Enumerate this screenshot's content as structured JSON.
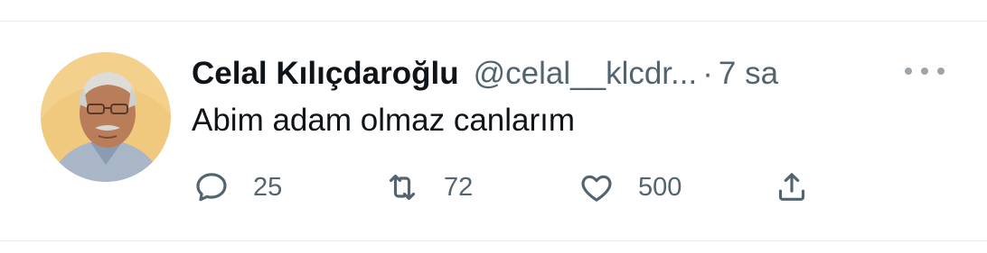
{
  "tweet": {
    "author": {
      "name": "Celal Kılıçdaroğlu",
      "handle": "@celal__klcdr...",
      "avatar": "author-avatar-photo"
    },
    "separator": "·",
    "time": "7 sa",
    "text": "Abim adam olmaz canlarım",
    "metrics": {
      "replies": "25",
      "retweets": "72",
      "likes": "500"
    },
    "icons": {
      "reply": "reply-icon",
      "retweet": "retweet-icon",
      "like": "heart-icon",
      "share": "share-icon",
      "more": "more-options-icon"
    }
  },
  "colors": {
    "primary_text": "#0f1419",
    "secondary_text": "#536471",
    "divider": "#e8ebed"
  }
}
